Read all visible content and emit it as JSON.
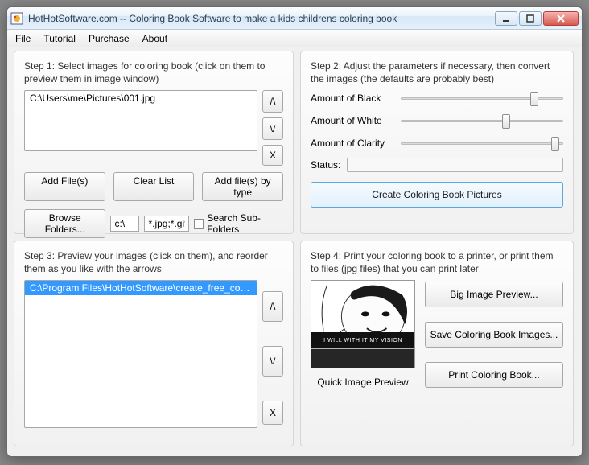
{
  "window": {
    "title": "HotHotSoftware.com -- Coloring Book Software to make a kids childrens coloring book"
  },
  "menu": {
    "file": "File",
    "tutorial": "Tutorial",
    "purchase": "Purchase",
    "about": "About"
  },
  "step1": {
    "label": "Step 1: Select images for coloring book (click on them to preview them in image window)",
    "items": [
      "C:\\Users\\me\\Pictures\\001.jpg"
    ],
    "up": "/\\",
    "down": "\\/",
    "remove": "X",
    "addFiles": "Add File(s)",
    "clearList": "Clear List",
    "addByType": "Add file(s) by type",
    "browse": "Browse Folders...",
    "path": "c:\\",
    "mask": "*.jpg;*.gif",
    "searchSub": "Search Sub-Folders"
  },
  "step2": {
    "label": "Step 2: Adjust the parameters if necessary, then convert the images (the defaults are probably best)",
    "black": "Amount of Black",
    "white": "Amount of White",
    "clarity": "Amount of Clarity",
    "status": "Status:",
    "create": "Create Coloring Book Pictures",
    "sliders": {
      "black": 82,
      "white": 65,
      "clarity": 95
    }
  },
  "step3": {
    "label": "Step 3: Preview your images (click on them), and reorder them as you like with the arrows",
    "items": [
      "C:\\Program Files\\HotHotSoftware\\create_free_coloring_"
    ],
    "up": "/\\",
    "down": "\\/",
    "remove": "X"
  },
  "step4": {
    "label": "Step 4: Print your coloring book to a printer, or print them to files (jpg files) that you can print later",
    "bigPreview": "Big Image Preview...",
    "save": "Save Coloring Book Images...",
    "print": "Print Coloring Book...",
    "previewCaption": "Quick Image Preview",
    "previewText": "I WILL WITH IT MY VISION"
  }
}
